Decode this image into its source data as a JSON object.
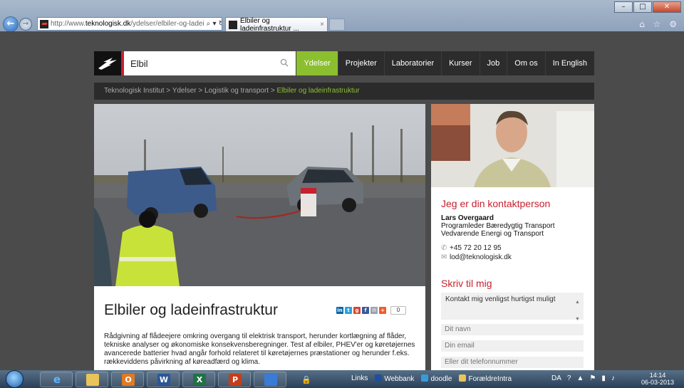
{
  "browser": {
    "url_prefix": "http://www.",
    "url_host": "teknologisk.dk",
    "url_path": "/ydelser/elbiler-og-ladei",
    "address_controls": "⌕ ▾ ↻ ✕",
    "tab_title": "Elbiler og ladeinfrastruktur ...",
    "tab_close": "×",
    "window_minimize": "–",
    "window_maximize": "□",
    "window_close": "✕",
    "back": "←",
    "forward": "→",
    "tools": "⌂ ☆ ⚙"
  },
  "site": {
    "search_value": "Elbil",
    "menu": [
      "Ydelser",
      "Projekter",
      "Laboratorier",
      "Kurser",
      "Job",
      "Om os",
      "In English"
    ],
    "active_menu_color": "#8cbf2f",
    "accent_color": "#c7202e"
  },
  "breadcrumb": {
    "path": "Teknologisk Institut > Ydelser > Logistik og transport > ",
    "current": "Elbiler og ladeinfrastruktur"
  },
  "article": {
    "title": "Elbiler og ladeinfrastruktur",
    "share_count": "0",
    "share_icons": [
      "linkedin-icon",
      "twitter-icon",
      "googleplus-icon",
      "facebook-icon",
      "email-icon",
      "addthis-icon"
    ],
    "lead": "Rådgivning af flådeejere omkring overgang til elektrisk transport, herunder kortlægning af flåder, tekniske analyser og økonomiske konsekvensberegninger. Test af elbiler, PHEV'er og køretøjernes avancerede batterier hvad angår forhold relateret til køretøjernes præstationer og herunder f.eks. rækkeviddens påvirkning af køreadfærd og klima."
  },
  "contact": {
    "heading": "Jeg er din kontaktperson",
    "name": "Lars Overgaard",
    "role_1": "Programleder Bæredygtig Transport",
    "role_2": "Vedvarende Energi og Transport",
    "phone": "+45 72 20 12 95",
    "email": "lod@teknologisk.dk"
  },
  "form": {
    "heading": "Skriv til mig",
    "message_value": "Kontakt mig venligst hurtigst muligt",
    "name_placeholder": "Dit navn",
    "email_placeholder": "Din email",
    "phone_placeholder": "Eller dit telefonnummer"
  },
  "taskbar": {
    "links_label": "Links",
    "links": [
      "Webbank",
      "doodle",
      "ForældreIntra"
    ],
    "language": "DA",
    "time": "14:14",
    "date": "06-03-2013"
  }
}
